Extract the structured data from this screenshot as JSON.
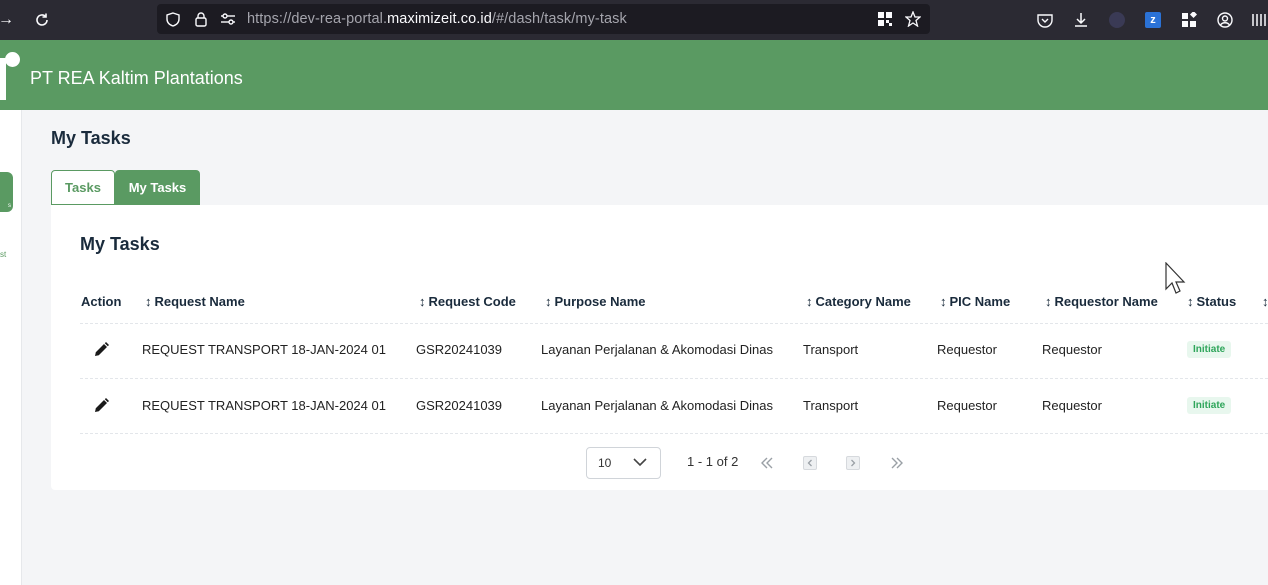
{
  "browser": {
    "url_prefix": "https://dev-rea-portal.",
    "url_domain": "maximizeit.co.id",
    "url_path": "/#/dash/task/my-task"
  },
  "header": {
    "company": "PT REA Kaltim Plantations"
  },
  "sidebar": {
    "active_item_label": "s",
    "item_label": "st"
  },
  "page": {
    "title": "My Tasks",
    "tabs": [
      {
        "label": "Tasks"
      },
      {
        "label": "My Tasks"
      }
    ]
  },
  "card": {
    "title": "My Tasks",
    "columns": [
      "Action",
      "Request Name",
      "Request Code",
      "Purpose Name",
      "Category Name",
      "PIC Name",
      "Requestor Name",
      "Status"
    ],
    "rows": [
      {
        "request_name": "REQUEST TRANSPORT 18-JAN-2024 01",
        "request_code": "GSR20241039",
        "purpose_name": "Layanan Perjalanan & Akomodasi Dinas",
        "category_name": "Transport",
        "pic_name": "Requestor",
        "requestor_name": "Requestor",
        "status": "Initiate"
      },
      {
        "request_name": "REQUEST TRANSPORT 18-JAN-2024 01",
        "request_code": "GSR20241039",
        "purpose_name": "Layanan Perjalanan & Akomodasi Dinas",
        "category_name": "Transport",
        "pic_name": "Requestor",
        "requestor_name": "Requestor",
        "status": "Initiate"
      }
    ]
  },
  "pagination": {
    "page_size": "10",
    "range": "1 - 1 of 2"
  },
  "colors": {
    "brand_green": "#5a9a62",
    "badge_green": "#2ea55a"
  }
}
